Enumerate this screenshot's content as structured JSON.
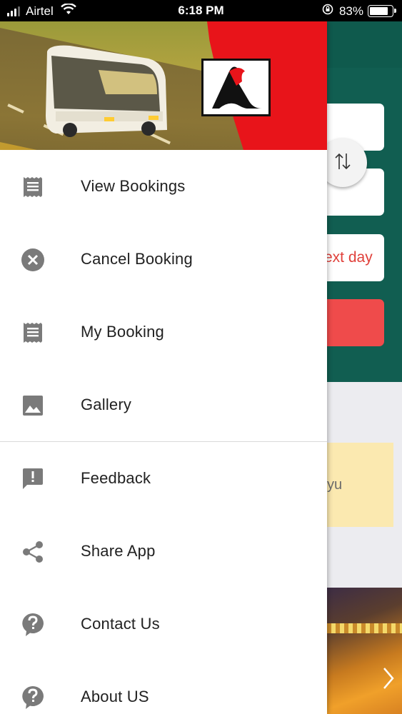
{
  "status_bar": {
    "carrier": "Airtel",
    "time": "6:18 PM",
    "battery": "83%",
    "battery_level": 0.83
  },
  "background": {
    "date_option": "Next day",
    "date_option_visible": "ext day",
    "notice_text_visible": "yu"
  },
  "drawer": {
    "menu_items": [
      {
        "label": "View Bookings",
        "icon": "receipt-icon"
      },
      {
        "label": "Cancel Booking",
        "icon": "cancel-icon"
      },
      {
        "label": "My Booking",
        "icon": "receipt-icon"
      },
      {
        "label": "Gallery",
        "icon": "image-icon"
      }
    ],
    "secondary_items": [
      {
        "label": "Feedback",
        "icon": "feedback-icon"
      },
      {
        "label": "Share App",
        "icon": "share-icon"
      },
      {
        "label": "Contact Us",
        "icon": "help-icon"
      },
      {
        "label": "About US",
        "icon": "help-icon"
      }
    ]
  },
  "colors": {
    "primary": "#115e51",
    "accent": "#ef4b4b",
    "icon_gray": "#7a7a7a",
    "header_red": "#e8141a"
  }
}
